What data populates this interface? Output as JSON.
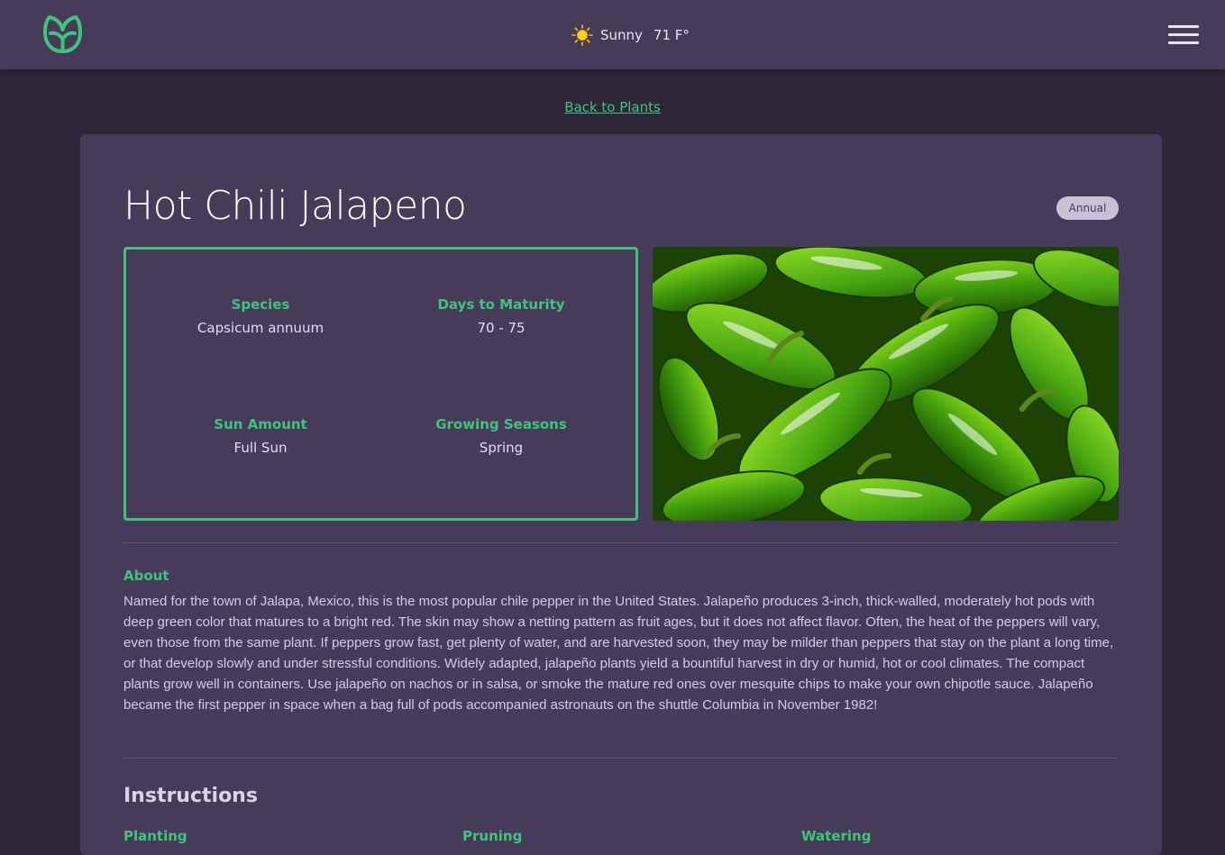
{
  "header": {
    "weather": {
      "condition": "Sunny",
      "temperature": "71 F°",
      "icon": "sun-icon"
    },
    "menu_icon": "hamburger-menu-icon",
    "logo_icon": "leaf-logo-icon",
    "accent_color": "#3ec47f"
  },
  "nav": {
    "back_label": "Back to Plants"
  },
  "plant": {
    "name": "Hot Chili Jalapeno",
    "badge": "Annual",
    "details": [
      {
        "label": "Species",
        "value": "Capsicum annuum"
      },
      {
        "label": "Days to Maturity",
        "value": "70 - 75"
      },
      {
        "label": "Sun Amount",
        "value": "Full Sun"
      },
      {
        "label": "Growing Seasons",
        "value": "Spring"
      }
    ],
    "about": {
      "heading": "About",
      "text": "Named for the town of Jalapa, Mexico, this is the most popular chile pepper in the United States. Jalapeño produces 3-inch, thick-walled, moderately hot pods with deep green color that matures to a bright red. The skin may show a netting pattern as fruit ages, but it does not affect flavor. Often, the heat of the peppers will vary, even those from the same plant. If peppers grow fast, get plenty of water, and are harvested soon, they may be milder than peppers that stay on the plant a long time, or that develop slowly and under stressful conditions. Widely adapted, jalapeño plants yield a bountiful harvest in dry or humid, hot or cool climates. The compact plants grow well in containers. Use jalapeño on nachos or in salsa, or smoke the mature red ones over mesquite chips to make your own chipotle sauce. Jalapeño became the first pepper in space when a bag full of pods accompanied astronauts on the shuttle Columbia in November 1982!"
    },
    "instructions": {
      "heading": "Instructions",
      "sections": [
        "Planting",
        "Pruning",
        "Watering"
      ]
    }
  }
}
